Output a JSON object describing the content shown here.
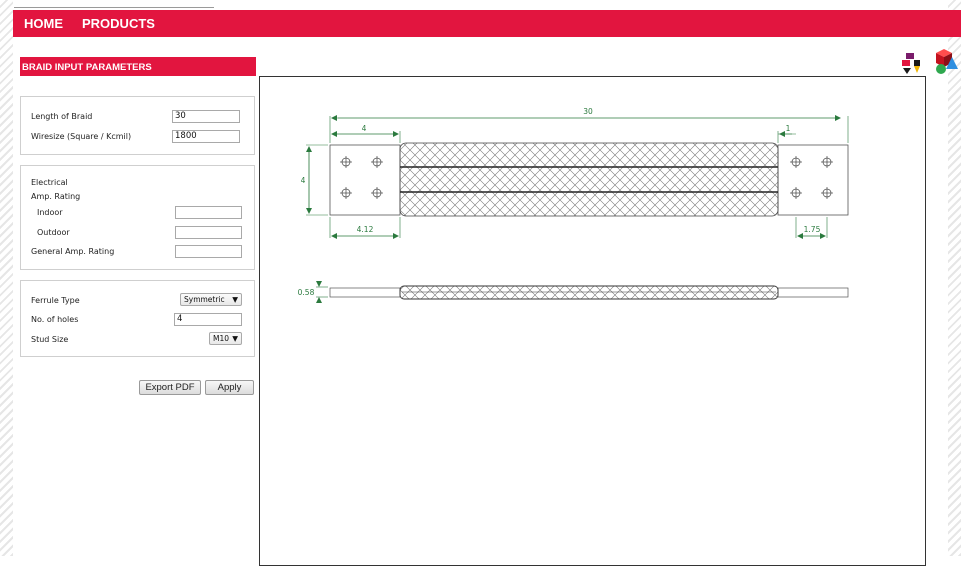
{
  "nav": {
    "home": "HOME",
    "products": "PRODUCTS"
  },
  "sidebar": {
    "title": "BRAID INPUT PARAMETERS",
    "length_label": "Length of Braid",
    "length_value": "30",
    "wiresize_label": "Wiresize (Square / Kcmil)",
    "wiresize_value": "1800",
    "electrical_label": "Electrical",
    "amp_rating_label": "Amp. Rating",
    "indoor_label": "Indoor",
    "indoor_value": "",
    "outdoor_label": "Outdoor",
    "outdoor_value": "",
    "general_amp_label": "General Amp. Rating",
    "general_amp_value": "",
    "ferrule_type_label": "Ferrule Type",
    "ferrule_type_value": "Symmetric",
    "holes_label": "No. of holes",
    "holes_value": "4",
    "stud_size_label": "Stud Size",
    "stud_size_value": "M10"
  },
  "actions": {
    "export_pdf": "Export PDF",
    "apply": "Apply"
  },
  "drawing": {
    "overall_length": "30",
    "left_ferrule_length": "4",
    "right_ferrule_length": "1",
    "height": "4",
    "left_hole_offset": "4.12",
    "right_hole_offset": "1.75",
    "thickness": "0.58"
  },
  "colors": {
    "brand_red": "#e2153f",
    "dimension_green": "#2b7a3e"
  },
  "icons": [
    "2d-view-icon",
    "3d-view-icon",
    "dropdown-caret-icon"
  ]
}
